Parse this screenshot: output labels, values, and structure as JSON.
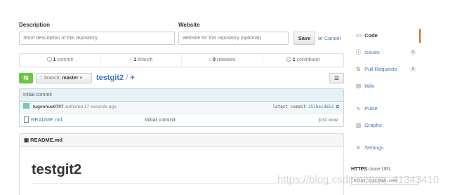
{
  "description": {
    "label": "Description",
    "placeholder": "Short description of this repository"
  },
  "website": {
    "label": "Website",
    "placeholder": "Website for this repository (optional)"
  },
  "actions": {
    "save_label": "Save",
    "or_text": "or",
    "cancel_label": "Cancel"
  },
  "stats": [
    {
      "icon": "commit-icon",
      "count": "1",
      "label": "commit"
    },
    {
      "icon": "branch-icon",
      "count": "1",
      "label": "branch"
    },
    {
      "icon": "tag-icon",
      "count": "0",
      "label": "releases"
    },
    {
      "icon": "contributor-icon",
      "count": "1",
      "label": "contributor"
    }
  ],
  "toolbar": {
    "branch_prefix": "branch:",
    "branch_name": "master",
    "repo_name": "testgit2",
    "separator": "/",
    "add_symbol": "+"
  },
  "commit": {
    "message": "Initial commit",
    "author": "tugenhua0707",
    "authored_text": "authored 17 seconds ago",
    "latest_label": "latest commit",
    "sha": "157becdd13"
  },
  "files": [
    {
      "name": "README.md",
      "message": "Initial commit",
      "age": "just now"
    }
  ],
  "readme": {
    "filename": "README.md",
    "heading": "testgit2"
  },
  "sidebar": {
    "items": [
      {
        "icon": "code-icon",
        "glyph": "<>",
        "label": "Code",
        "counter": ""
      },
      {
        "icon": "issues-icon",
        "glyph": "ⓘ",
        "label": "Issues",
        "counter": "0"
      },
      {
        "icon": "pull-request-icon",
        "glyph": "⇅",
        "label": "Pull Requests",
        "counter": "0"
      },
      {
        "icon": "wiki-icon",
        "glyph": "▤",
        "label": "Wiki",
        "counter": ""
      },
      {
        "icon": "pulse-icon",
        "glyph": "∿",
        "label": "Pulse",
        "counter": ""
      },
      {
        "icon": "graphs-icon",
        "glyph": "▥",
        "label": "Graphs",
        "counter": ""
      },
      {
        "icon": "settings-icon",
        "glyph": "✕",
        "label": "Settings",
        "counter": ""
      }
    ]
  },
  "clone": {
    "protocol": "HTTPS",
    "label": "clone URL",
    "url": "https://github.com/"
  },
  "watermark": "https://blog.csdn.net/qq_41343410",
  "colors": {
    "accent": "#4078c0",
    "compare_green": "#6cc644",
    "selected_tab": "#d26911"
  }
}
